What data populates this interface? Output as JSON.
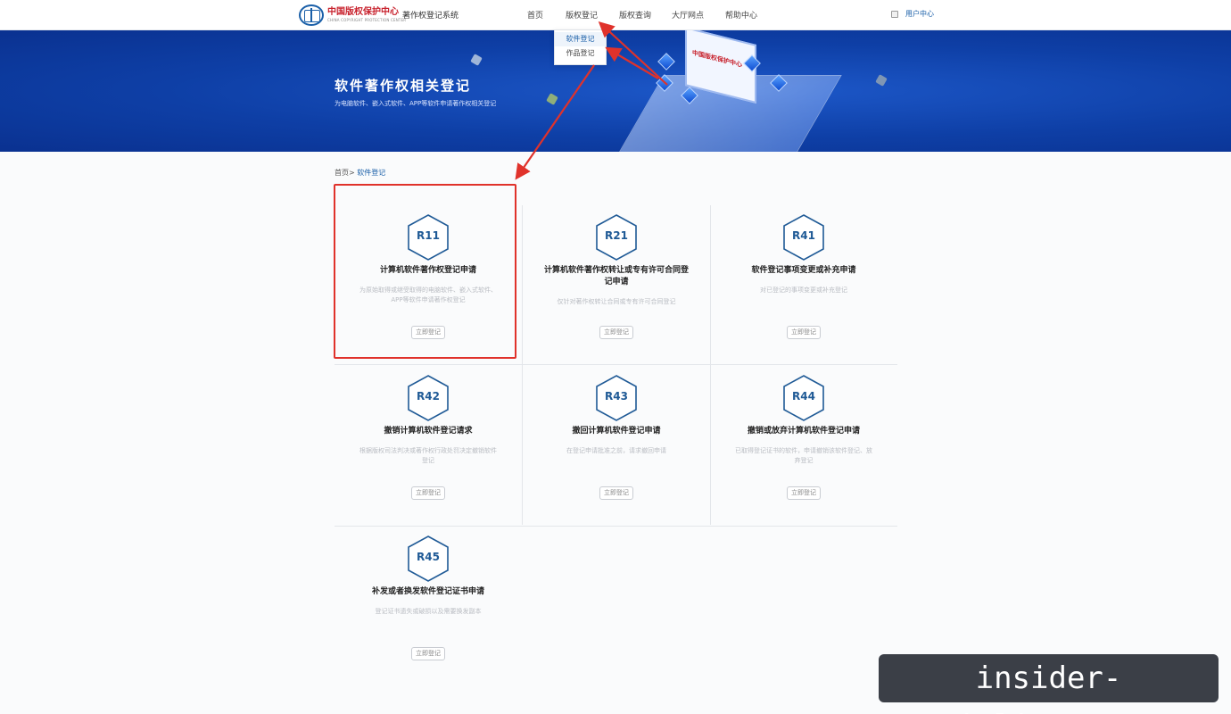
{
  "header": {
    "org_name_cn": "中国版权保护中心",
    "org_name_en": "CHINA COPYRIGHT PROTECTION CENTER",
    "system_name": "著作权登记系统",
    "nav": [
      "首页",
      "版权登记",
      "版权查询",
      "大厅网点",
      "帮助中心"
    ],
    "user_center": "用户中心"
  },
  "dropdown": {
    "items": [
      "软件登记",
      "作品登记"
    ],
    "active": "软件登记"
  },
  "banner": {
    "title": "软件著作权相关登记",
    "subtitle": "为电脑软件、嵌入式软件、APP等软件申请著作权相关登记"
  },
  "breadcrumb": {
    "home": "首页>",
    "current": "软件登记"
  },
  "cards": [
    {
      "code": "R11",
      "title": "计算机软件著作权登记申请",
      "desc": "为原始取得或继受取得的电脑软件、嵌入式软件、APP等软件申请著作权登记",
      "button": "立即登记"
    },
    {
      "code": "R21",
      "title": "计算机软件著作权转让或专有许可合同登记申请",
      "desc": "仅针对著作权转让合同或专有许可合同登记",
      "button": "立即登记"
    },
    {
      "code": "R41",
      "title": "软件登记事项变更或补充申请",
      "desc": "对已登记的事项变更或补充登记",
      "button": "立即登记"
    },
    {
      "code": "R42",
      "title": "撤销计算机软件登记请求",
      "desc": "根据版权司法判决或著作权行政处罚决定撤销软件登记",
      "button": "立即登记"
    },
    {
      "code": "R43",
      "title": "撤回计算机软件登记申请",
      "desc": "在登记申请批准之前，请求撤回申请",
      "button": "立即登记"
    },
    {
      "code": "R44",
      "title": "撤销或放弃计算机软件登记申请",
      "desc": "已取得登记证书的软件，申请撤销该软件登记、放弃登记",
      "button": "立即登记"
    },
    {
      "code": "R45",
      "title": "补发或者换发软件登记证书申请",
      "desc": "登记证书遗失或破损以及需要换发副本",
      "button": "立即登记"
    }
  ],
  "watermark": "insider-xinli.com.cn",
  "colors": {
    "brand_blue": "#1a5fa8",
    "banner_blue": "#0e3fa6",
    "annotation_red": "#e0322b"
  }
}
